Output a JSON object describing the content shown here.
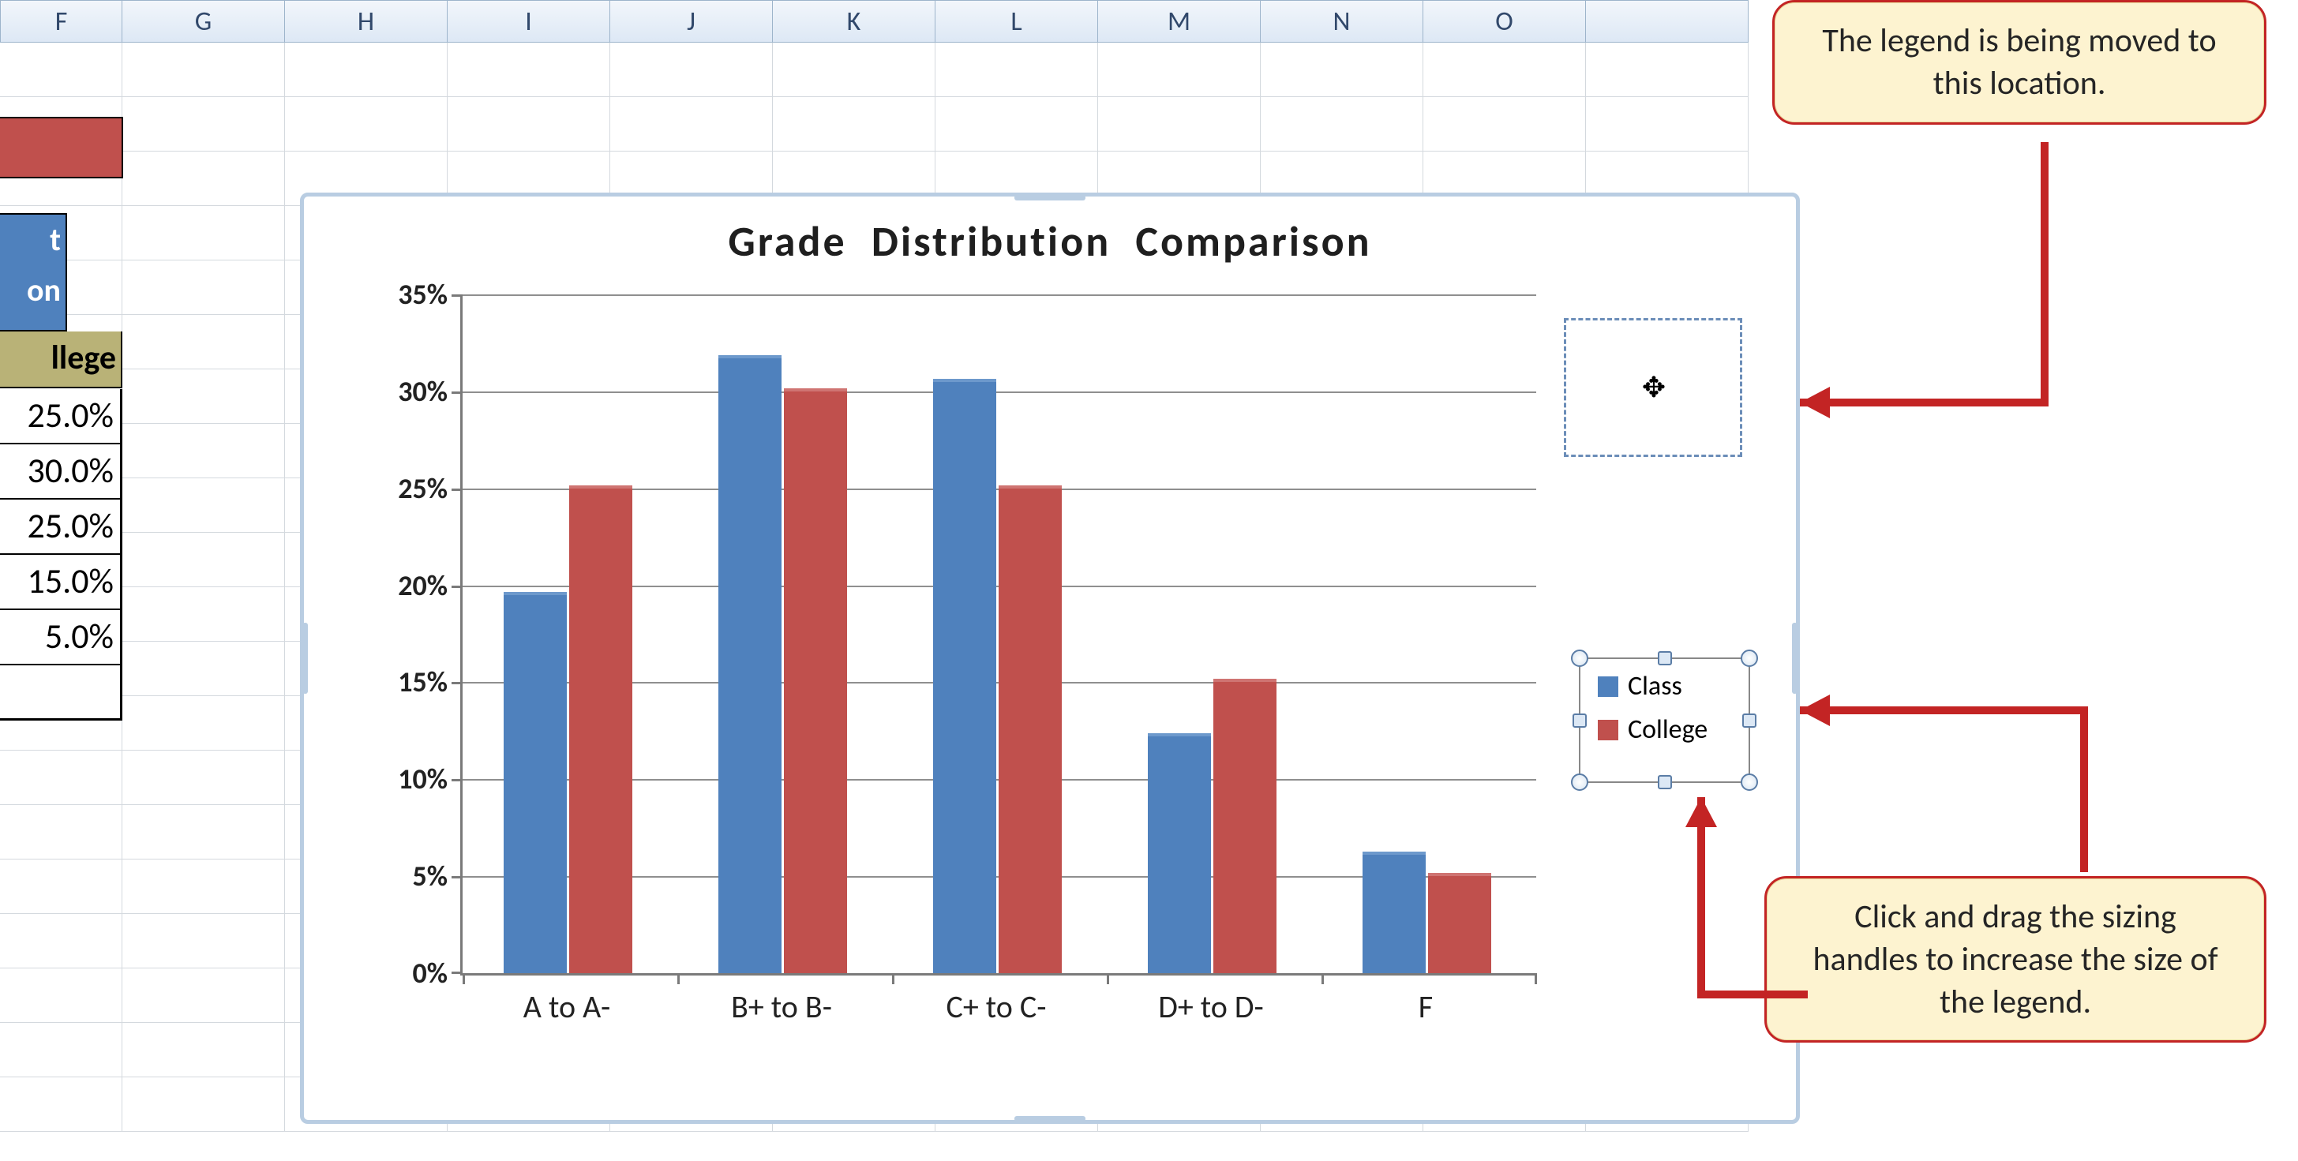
{
  "columns": [
    "F",
    "G",
    "H",
    "I",
    "J",
    "K",
    "L",
    "M",
    "N",
    "O",
    ""
  ],
  "left_fragments": {
    "blue_line1": "t",
    "blue_line2": "on",
    "olive": "llege",
    "pct_values": [
      "25.0%",
      "30.0%",
      "25.0%",
      "15.0%",
      "5.0%"
    ]
  },
  "callouts": {
    "top": "The legend is being moved to this location.",
    "bottom": "Click and drag the sizing handles to increase the size of the legend."
  },
  "legend_ghost_cursor": "✥",
  "chart_data": {
    "type": "bar",
    "title": "Grade Distribution Comparison",
    "xlabel": "",
    "ylabel": "",
    "ylim": [
      0,
      35
    ],
    "ytick_step": 5,
    "yticks": [
      "0%",
      "5%",
      "10%",
      "15%",
      "20%",
      "25%",
      "30%",
      "35%"
    ],
    "categories": [
      "A to A-",
      "B+ to B-",
      "C+ to C-",
      "D+ to D-",
      "F"
    ],
    "series": [
      {
        "name": "Class",
        "color": "#4f81bd",
        "values": [
          19.5,
          31.7,
          30.5,
          12.2,
          6.1
        ]
      },
      {
        "name": "College",
        "color": "#c0504d",
        "values": [
          25.0,
          30.0,
          25.0,
          15.0,
          5.0
        ]
      }
    ]
  }
}
